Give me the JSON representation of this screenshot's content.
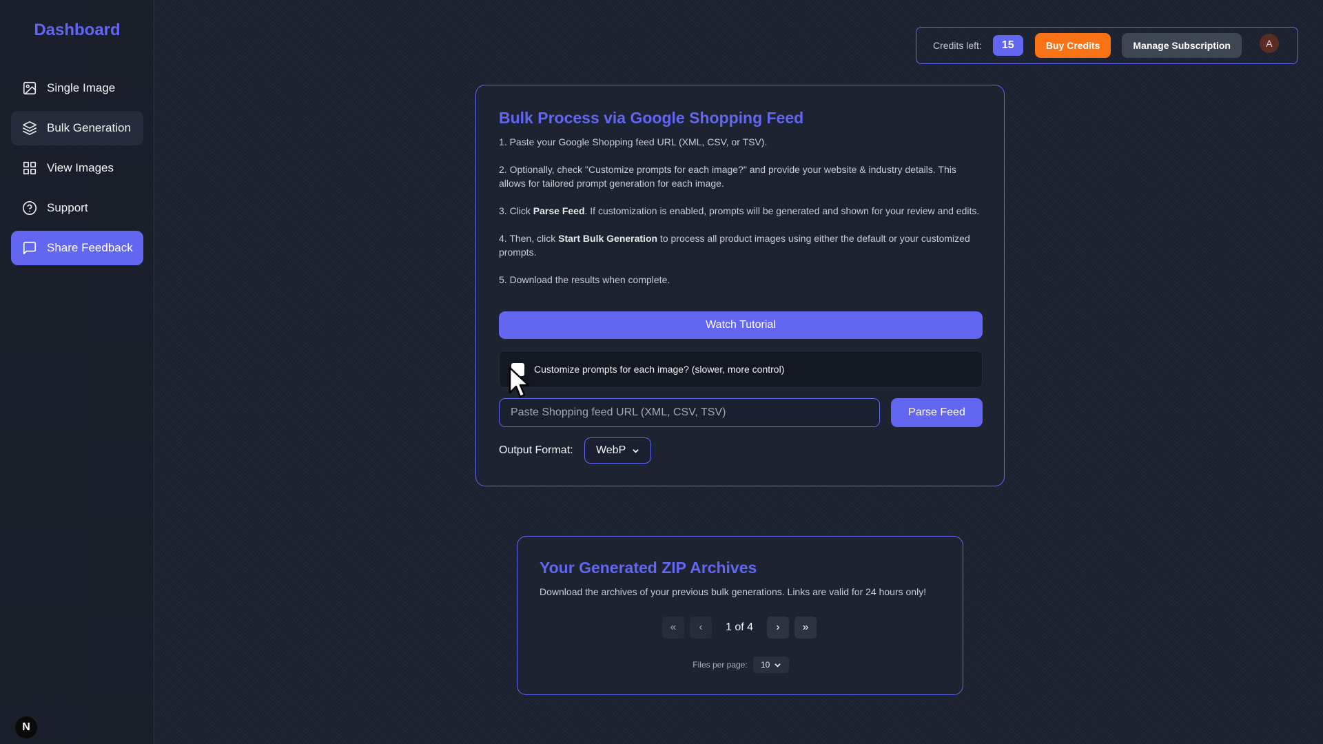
{
  "sidebar": {
    "brand": "Dashboard",
    "items": [
      {
        "label": "Single Image",
        "icon": "image-icon"
      },
      {
        "label": "Bulk Generation",
        "icon": "layers-icon"
      },
      {
        "label": "View Images",
        "icon": "grid-icon"
      },
      {
        "label": "Support",
        "icon": "help-circle-icon"
      },
      {
        "label": "Share Feedback",
        "icon": "message-square-icon"
      }
    ],
    "badge": "N"
  },
  "topbar": {
    "credits_label": "Credits left:",
    "credits_count": "15",
    "buy_label": "Buy Credits",
    "manage_label": "Manage Subscription",
    "avatar_initial": "A"
  },
  "bulk": {
    "title": "Bulk Process via Google Shopping Feed",
    "steps": [
      {
        "pre": "1. Paste your Google Shopping feed URL (XML, CSV, or TSV).",
        "bold": "",
        "post": ""
      },
      {
        "pre": "2. Optionally, check \"Customize prompts for each image?\" and provide your website & industry details. This allows for tailored prompt generation for each image.",
        "bold": "",
        "post": ""
      },
      {
        "pre": "3. Click ",
        "bold": "Parse Feed",
        "post": ". If customization is enabled, prompts will be generated and shown for your review and edits."
      },
      {
        "pre": "4. Then, click ",
        "bold": "Start Bulk Generation",
        "post": " to process all product images using either the default or your customized prompts."
      },
      {
        "pre": "5. Download the results when complete.",
        "bold": "",
        "post": ""
      }
    ],
    "watch_label": "Watch Tutorial",
    "customize_label": "Customize prompts for each image? (slower, more control)",
    "customize_checked": false,
    "url_placeholder": "Paste Shopping feed URL (XML, CSV, TSV)",
    "url_value": "",
    "parse_label": "Parse Feed",
    "format_label": "Output Format:",
    "format_value": "WebP"
  },
  "archives": {
    "title": "Your Generated ZIP Archives",
    "description": "Download the archives of your previous bulk generations. Links are valid for 24 hours only!",
    "first_glyph": "«",
    "prev_glyph": "‹",
    "page_label": "1 of 4",
    "next_glyph": "›",
    "last_glyph": "»",
    "per_page_label": "Files per page:",
    "per_page_value": "10"
  },
  "colors": {
    "accent": "#6366f1",
    "buy": "#f97316",
    "manage": "#3f4653",
    "background": "#1c2230"
  }
}
